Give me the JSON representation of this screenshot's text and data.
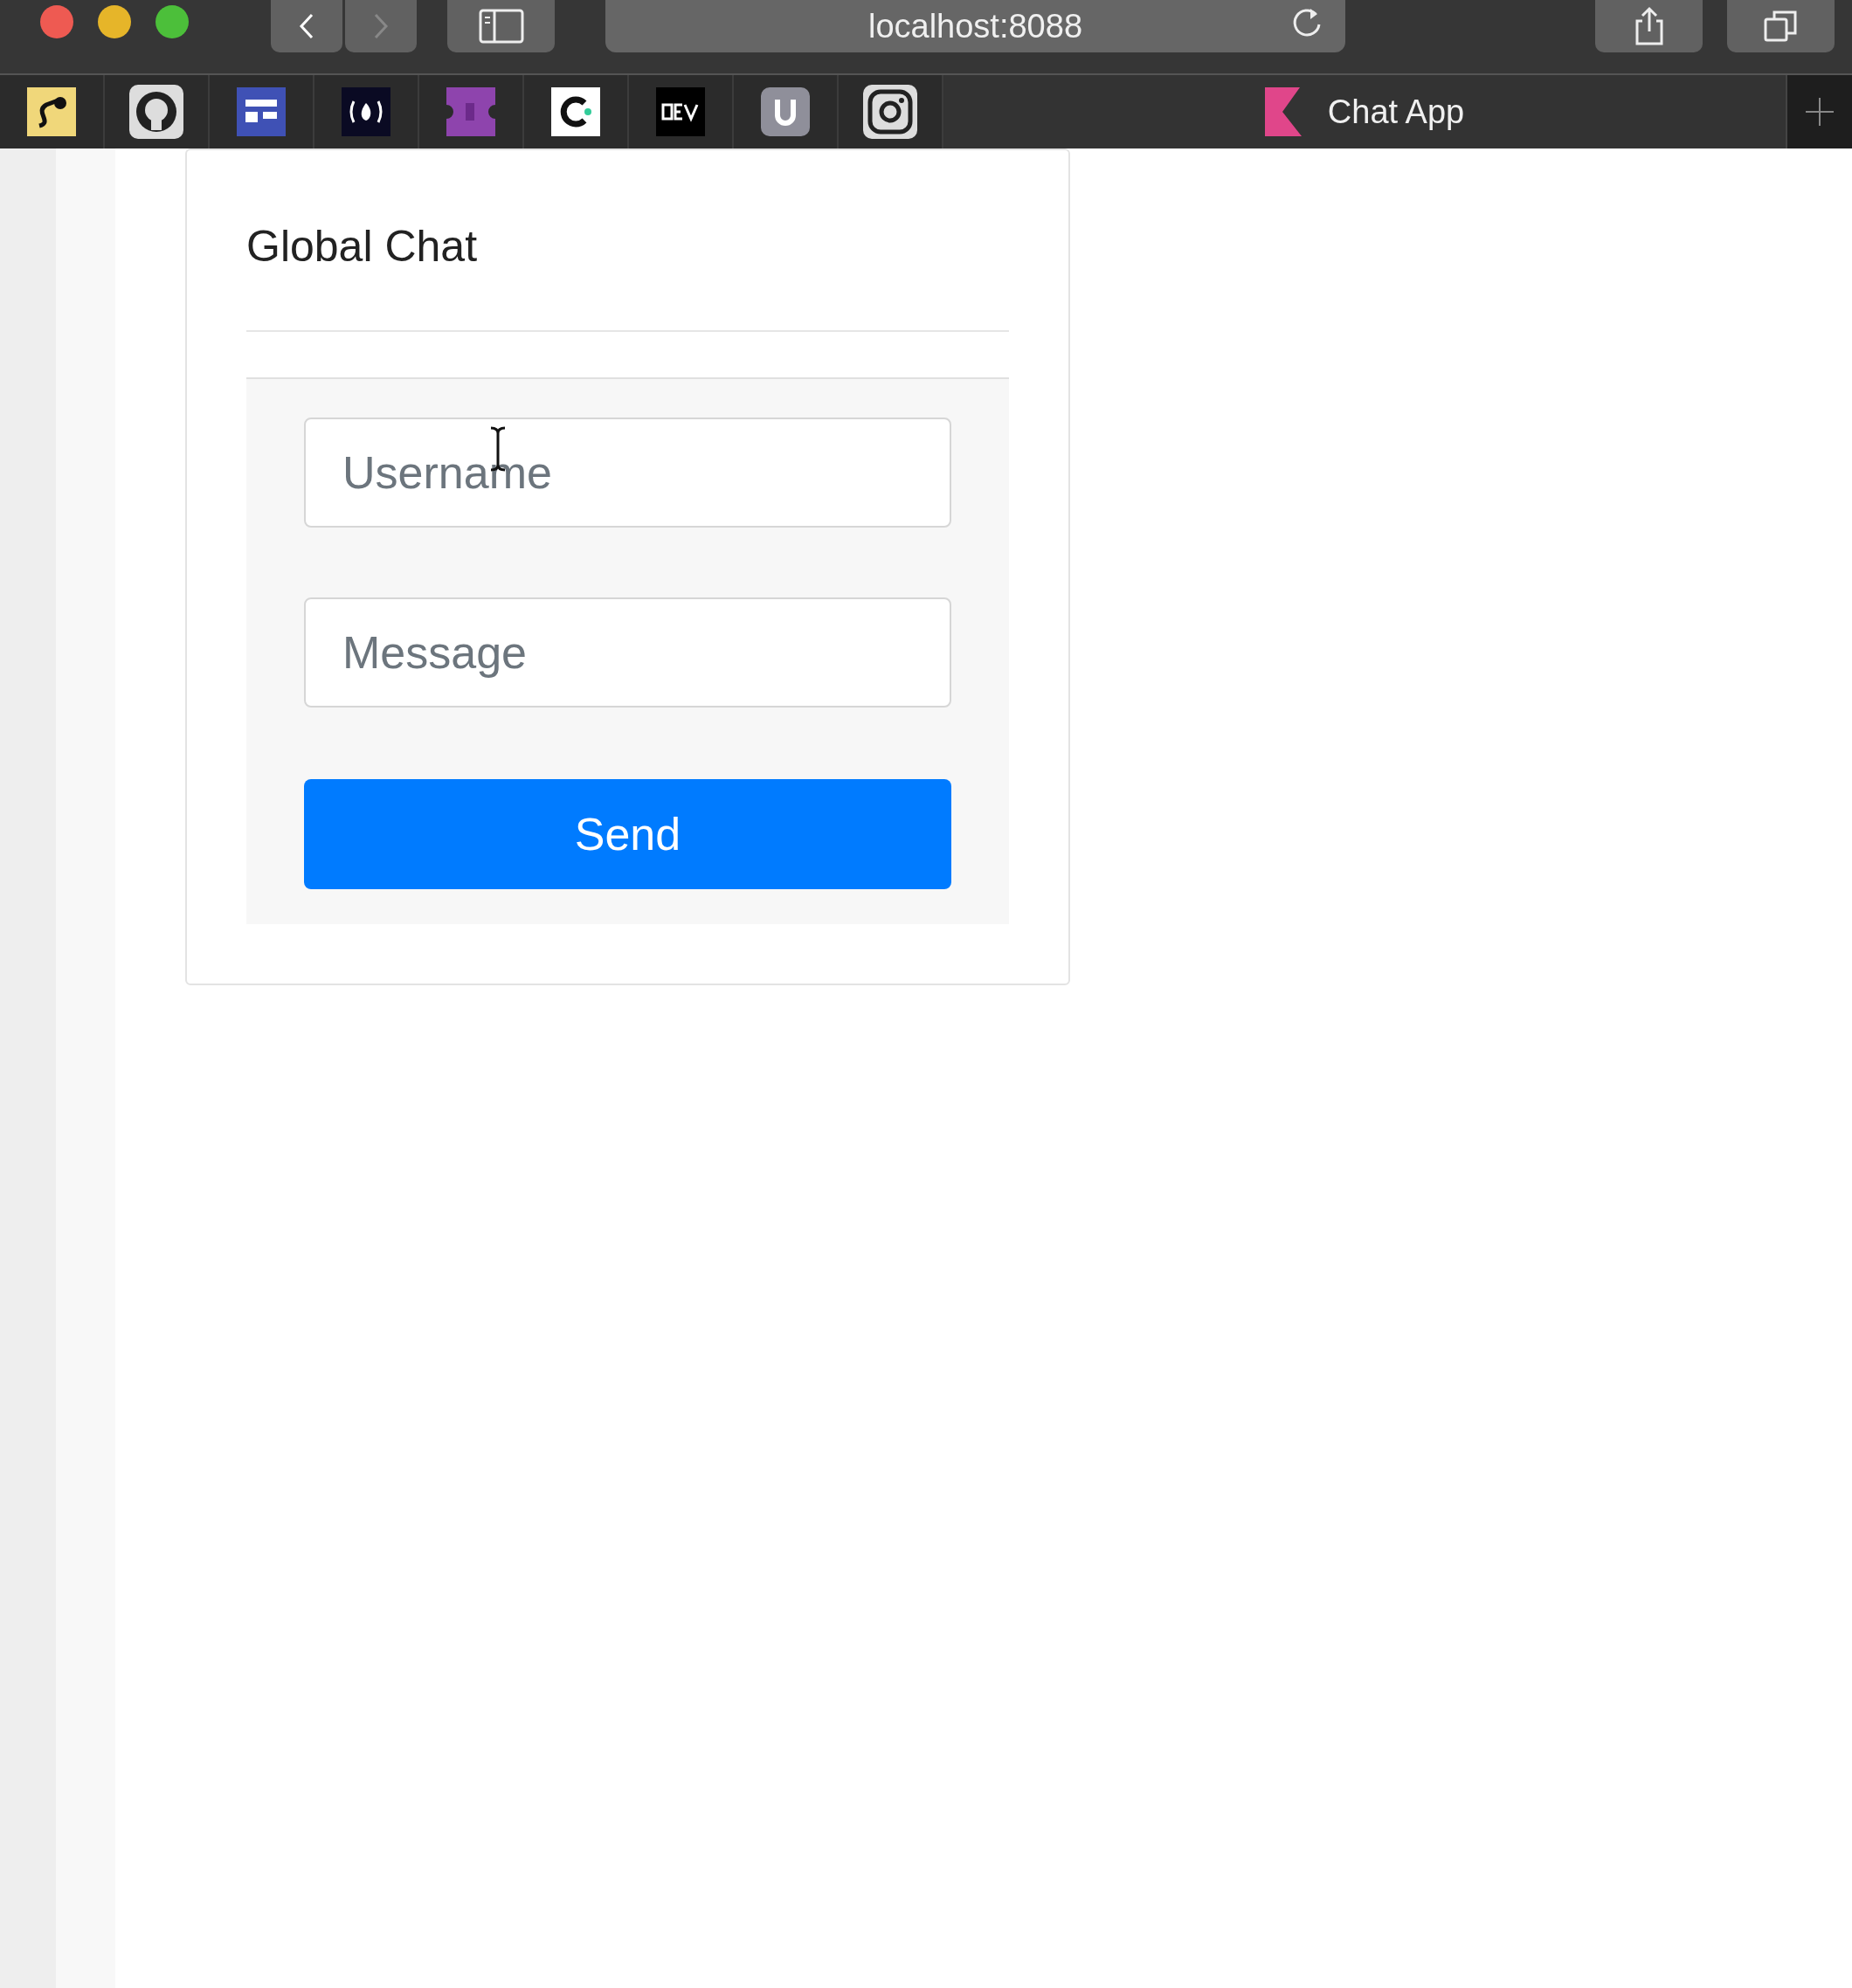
{
  "browser": {
    "address": "localhost:8088",
    "tab": {
      "title": "Chat App",
      "selected": true
    }
  },
  "chat": {
    "title": "Global Chat",
    "fields": [
      {
        "placeholder": "Username"
      },
      {
        "placeholder": "Message"
      }
    ],
    "send_button": "Send"
  }
}
